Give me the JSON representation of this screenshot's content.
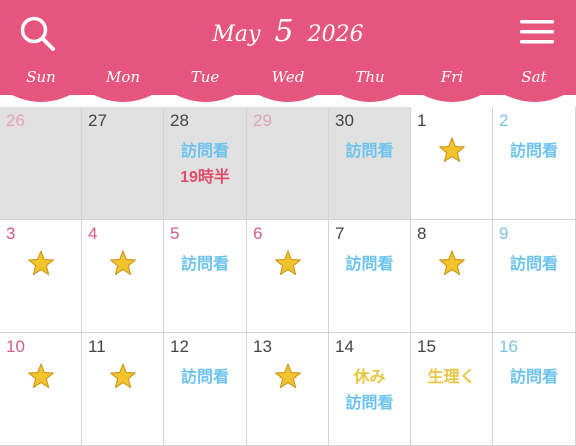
{
  "header": {
    "month": "May",
    "day": "5",
    "year": "2026",
    "bg_color": "#e6557e",
    "search_icon": "search-icon",
    "menu_icon": "hamburger-menu-icon"
  },
  "weekdays": [
    "Sun",
    "Mon",
    "Tue",
    "Wed",
    "Thu",
    "Fri",
    "Sat"
  ],
  "colors": {
    "event_blue": "#6cc3ee",
    "event_red": "#e14b6d",
    "event_yellow": "#e8c542",
    "star": "#f2c32c",
    "outside_month_bg": "#e1e1e1"
  },
  "weeks": [
    {
      "days": [
        {
          "num": "26",
          "tone": "sun",
          "outside": true,
          "items": []
        },
        {
          "num": "27",
          "tone": "plain",
          "outside": true,
          "items": []
        },
        {
          "num": "28",
          "tone": "plain",
          "outside": true,
          "items": [
            {
              "type": "text",
              "text": "訪問看",
              "color": "blue"
            },
            {
              "type": "text",
              "text": "19時半",
              "color": "red"
            }
          ]
        },
        {
          "num": "29",
          "tone": "holiday",
          "outside": true,
          "items": []
        },
        {
          "num": "30",
          "tone": "plain",
          "outside": true,
          "items": [
            {
              "type": "text",
              "text": "訪問看",
              "color": "blue"
            }
          ]
        },
        {
          "num": "1",
          "tone": "plain",
          "outside": false,
          "items": [
            {
              "type": "star"
            }
          ]
        },
        {
          "num": "2",
          "tone": "sat",
          "outside": false,
          "items": [
            {
              "type": "text",
              "text": "訪問看",
              "color": "blue"
            }
          ]
        }
      ]
    },
    {
      "days": [
        {
          "num": "3",
          "tone": "sun",
          "outside": false,
          "items": [
            {
              "type": "star"
            }
          ]
        },
        {
          "num": "4",
          "tone": "holiday",
          "outside": false,
          "items": [
            {
              "type": "star"
            }
          ]
        },
        {
          "num": "5",
          "tone": "holiday",
          "outside": false,
          "items": [
            {
              "type": "text",
              "text": "訪問看",
              "color": "blue"
            }
          ]
        },
        {
          "num": "6",
          "tone": "holiday",
          "outside": false,
          "items": [
            {
              "type": "star"
            }
          ]
        },
        {
          "num": "7",
          "tone": "plain",
          "outside": false,
          "items": [
            {
              "type": "text",
              "text": "訪問看",
              "color": "blue"
            }
          ]
        },
        {
          "num": "8",
          "tone": "plain",
          "outside": false,
          "items": [
            {
              "type": "star"
            }
          ]
        },
        {
          "num": "9",
          "tone": "sat",
          "outside": false,
          "items": [
            {
              "type": "text",
              "text": "訪問看",
              "color": "blue"
            }
          ]
        }
      ]
    },
    {
      "days": [
        {
          "num": "10",
          "tone": "sun",
          "outside": false,
          "items": [
            {
              "type": "star"
            }
          ]
        },
        {
          "num": "11",
          "tone": "plain",
          "outside": false,
          "items": [
            {
              "type": "star"
            }
          ]
        },
        {
          "num": "12",
          "tone": "plain",
          "outside": false,
          "items": [
            {
              "type": "text",
              "text": "訪問看",
              "color": "blue"
            }
          ]
        },
        {
          "num": "13",
          "tone": "plain",
          "outside": false,
          "items": [
            {
              "type": "star"
            }
          ]
        },
        {
          "num": "14",
          "tone": "plain",
          "outside": false,
          "items": [
            {
              "type": "text",
              "text": "休み",
              "color": "yellow"
            },
            {
              "type": "text",
              "text": "訪問看",
              "color": "blue"
            }
          ]
        },
        {
          "num": "15",
          "tone": "plain",
          "outside": false,
          "items": [
            {
              "type": "text",
              "text": "生理く",
              "color": "yellow"
            }
          ]
        },
        {
          "num": "16",
          "tone": "sat",
          "outside": false,
          "items": [
            {
              "type": "text",
              "text": "訪問看",
              "color": "blue"
            }
          ]
        }
      ]
    }
  ]
}
